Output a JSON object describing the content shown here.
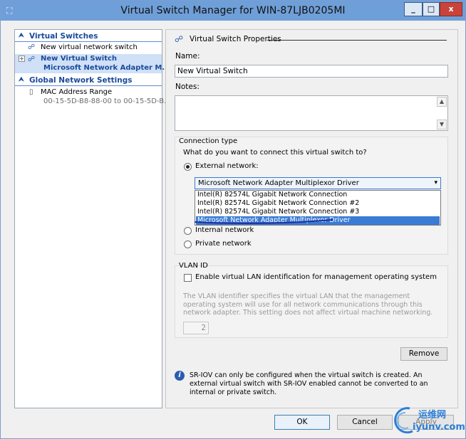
{
  "window": {
    "title": "Virtual Switch Manager for WIN-87LJB0205MI",
    "controls": {
      "minimize": "_",
      "maximize": "□",
      "close": "x"
    }
  },
  "sidebar": {
    "virtual_switches_header": "Virtual Switches",
    "new_switch_item": "New virtual network switch",
    "selected_switch_name": "New Virtual Switch",
    "selected_switch_adapter": "Microsoft Network Adapter M...",
    "global_header": "Global Network Settings",
    "mac_label": "MAC Address Range",
    "mac_value": "00-15-5D-B8-88-00 to 00-15-5D-B..."
  },
  "properties": {
    "section_title": "Virtual Switch Properties",
    "name_label": "Name:",
    "name_value": "New Virtual Switch",
    "notes_label": "Notes:",
    "notes_value": ""
  },
  "connection": {
    "group_label": "Connection type",
    "question": "What do you want to connect this virtual switch to?",
    "external_label": "External network:",
    "selected_adapter": "Microsoft Network Adapter Multiplexor Driver",
    "dropdown_options": [
      "Intel(R) 82574L Gigabit Network Connection",
      "Intel(R) 82574L Gigabit Network Connection #2",
      "Intel(R) 82574L Gigabit Network Connection #3",
      "Microsoft Network Adapter Multiplexor Driver"
    ],
    "internal_label": "Internal network",
    "private_label": "Private network"
  },
  "vlan": {
    "group_label": "VLAN ID",
    "checkbox_label": "Enable virtual LAN identification for management operating system",
    "description": "The VLAN identifier specifies the virtual LAN that the management operating system will use for all network communications through this network adapter. This setting does not affect virtual machine networking.",
    "id_value": "2"
  },
  "remove_button": "Remove",
  "info_text": "SR-IOV can only be configured when the virtual switch is created. An external virtual switch with SR-IOV enabled cannot be converted to an internal or private switch.",
  "footer": {
    "ok": "OK",
    "cancel": "Cancel",
    "apply": "Apply"
  },
  "watermark": {
    "cn": "运维网",
    "url": "iyunv.com"
  },
  "colors": {
    "titlebar": "#6f9fd8",
    "selection": "#3a7bd5",
    "close": "#c7433b",
    "link": "#1a4a9a"
  }
}
